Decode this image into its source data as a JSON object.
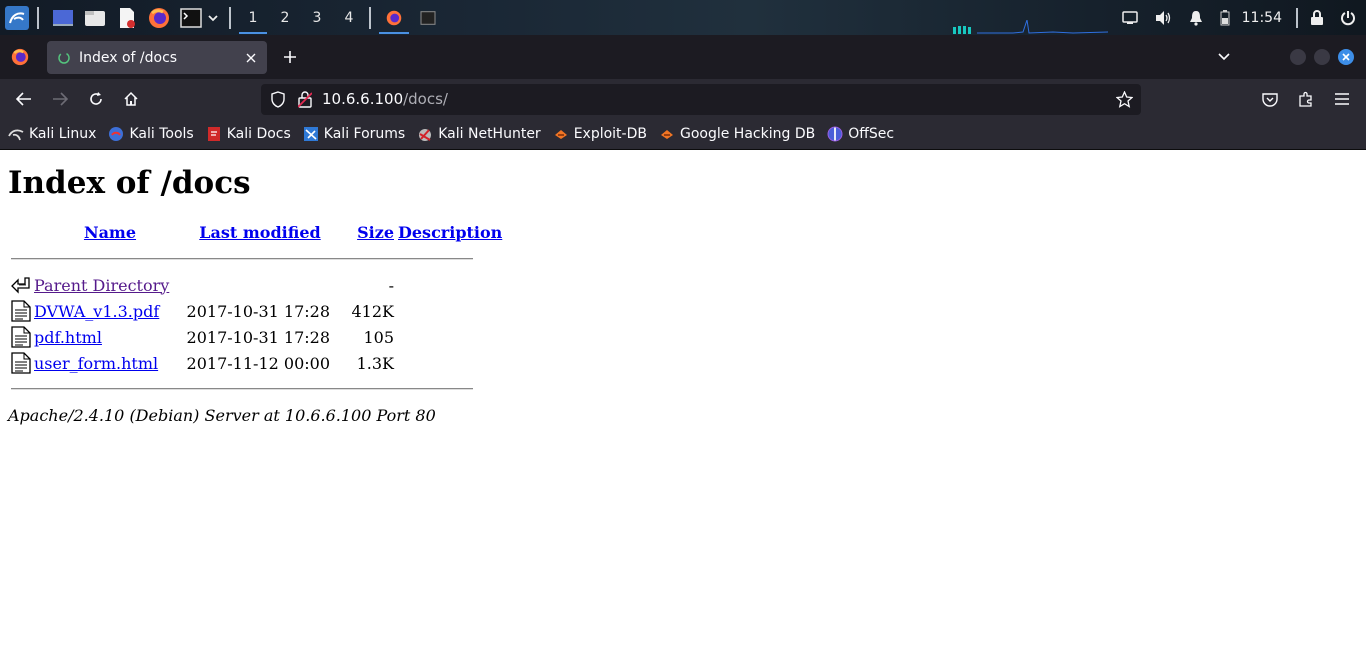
{
  "taskbar": {
    "workspaces": [
      "1",
      "2",
      "3",
      "4"
    ],
    "active_workspace": "1",
    "clock": "11:54",
    "icons": [
      "kali-menu-icon",
      "desktop-icon",
      "file-manager-icon",
      "text-editor-icon",
      "firefox-icon",
      "terminal-icon",
      "chevron-down-icon"
    ],
    "tray_icons": [
      "network-icon",
      "volume-icon",
      "notification-icon",
      "battery-icon",
      "lock-icon",
      "power-icon"
    ]
  },
  "browser": {
    "tab_title": "Index of /docs",
    "url_host": "10.6.6.100",
    "url_path": "/docs/",
    "colors": {
      "accent": "#3d8ee8",
      "chrome_dark": "#1c1b22",
      "toolbar": "#2b2a33",
      "active_tab": "#42414d"
    }
  },
  "bookmarks": [
    {
      "label": "Kali Linux",
      "icon": "kali-dragon-icon"
    },
    {
      "label": "Kali Tools",
      "icon": "kali-tools-icon"
    },
    {
      "label": "Kali Docs",
      "icon": "kali-docs-icon"
    },
    {
      "label": "Kali Forums",
      "icon": "kali-forums-icon"
    },
    {
      "label": "Kali NetHunter",
      "icon": "nethunter-icon"
    },
    {
      "label": "Exploit-DB",
      "icon": "exploit-db-icon"
    },
    {
      "label": "Google Hacking DB",
      "icon": "ghdb-icon"
    },
    {
      "label": "OffSec",
      "icon": "offsec-icon"
    }
  ],
  "page": {
    "heading": "Index of /docs",
    "columns": {
      "name": "Name",
      "modified": "Last modified",
      "size": "Size",
      "description": "Description"
    },
    "parent": {
      "name": "Parent Directory",
      "size": "-"
    },
    "rows": [
      {
        "name": "DVWA_v1.3.pdf",
        "modified": "2017-10-31 17:28",
        "size": "412K",
        "description": ""
      },
      {
        "name": "pdf.html",
        "modified": "2017-10-31 17:28",
        "size": "105",
        "description": ""
      },
      {
        "name": "user_form.html",
        "modified": "2017-11-12 00:00",
        "size": "1.3K",
        "description": ""
      }
    ],
    "footer": "Apache/2.4.10 (Debian) Server at 10.6.6.100 Port 80"
  }
}
